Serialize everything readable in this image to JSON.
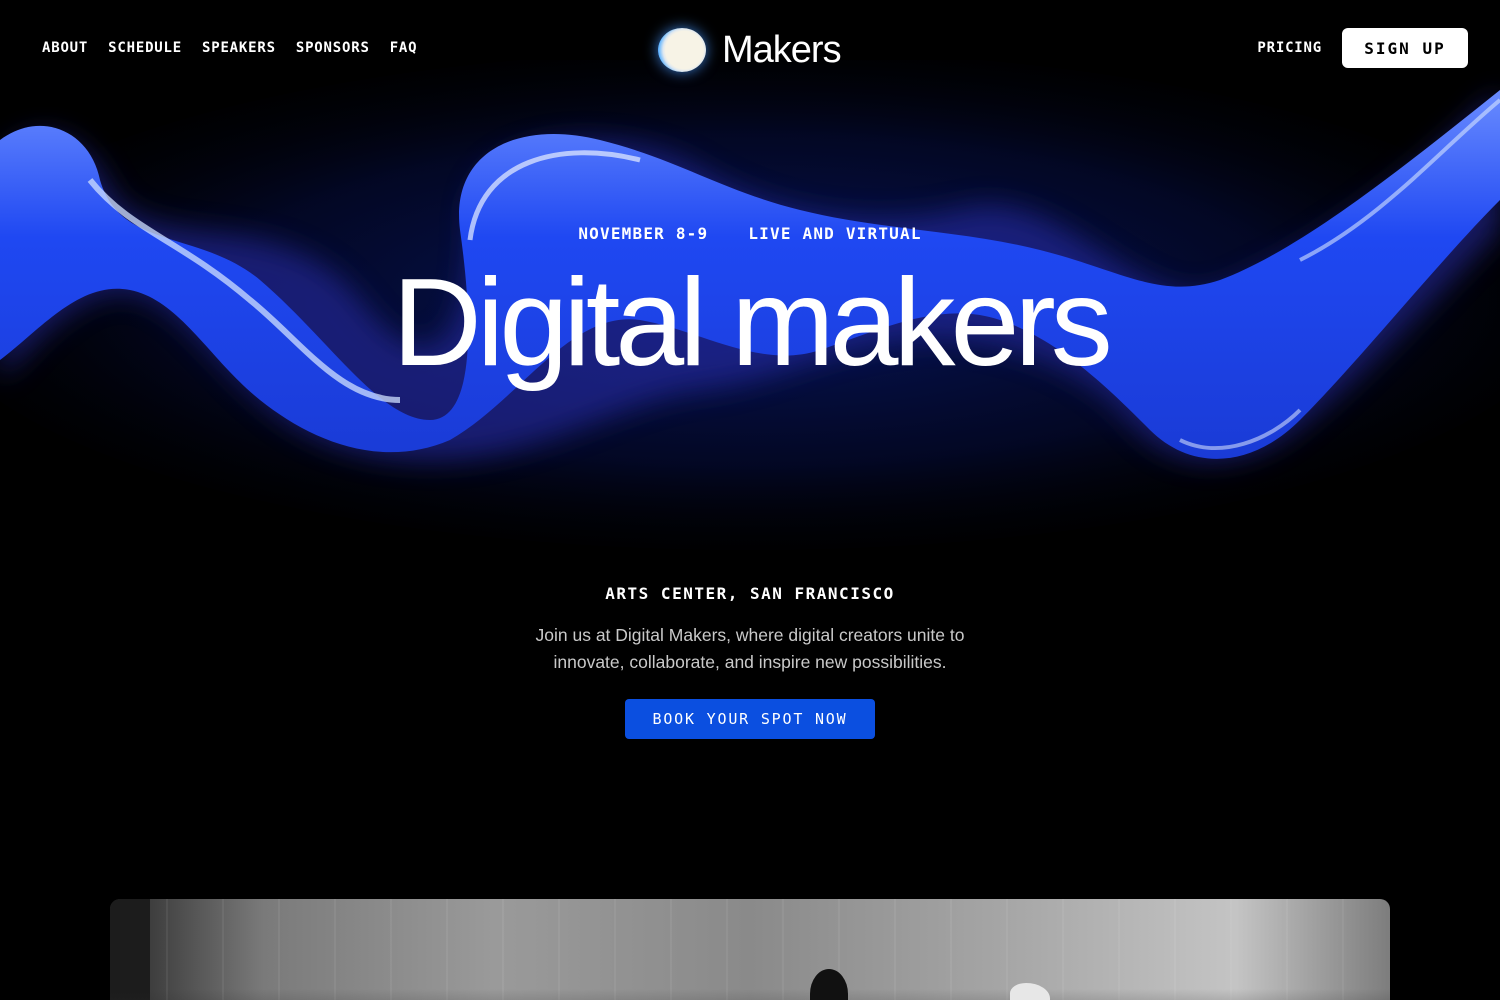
{
  "nav": {
    "links": [
      "ABOUT",
      "SCHEDULE",
      "SPEAKERS",
      "SPONSORS",
      "FAQ"
    ],
    "brand": "Makers",
    "pricing": "PRICING",
    "signup": "SIGN UP"
  },
  "hero": {
    "date": "NOVEMBER 8-9",
    "mode": "LIVE AND VIRTUAL",
    "title": "Digital makers",
    "location": "ARTS CENTER, SAN FRANCISCO",
    "description": "Join us at Digital Makers, where digital creators unite to innovate, collaborate, and inspire new possibilities.",
    "cta": "BOOK YOUR SPOT NOW"
  },
  "colors": {
    "background": "#000000",
    "accent": "#0b4fe0",
    "ribbon": "#1e4cff"
  },
  "icons": {
    "logo": "glowing-orb-icon"
  }
}
